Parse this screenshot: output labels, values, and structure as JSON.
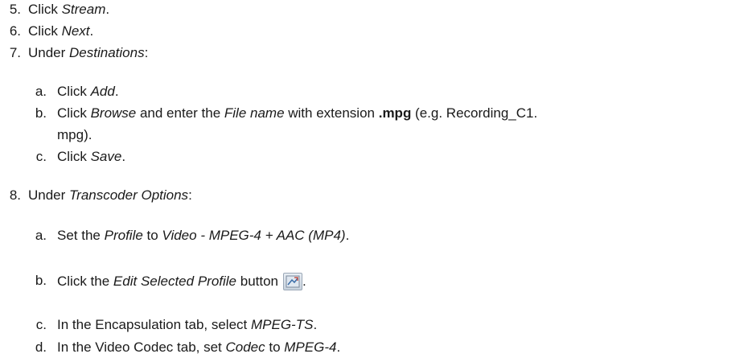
{
  "steps": [
    {
      "num": "5.",
      "pre": "Click ",
      "em": "Stream",
      "post": "."
    },
    {
      "num": "6.",
      "pre": "Click ",
      "em": "Next",
      "post": "."
    },
    {
      "num": "7.",
      "pre": "Under ",
      "em": "Destinations",
      "post": ":"
    }
  ],
  "step7_sub": {
    "a": {
      "letter": "a.",
      "pre": "Click ",
      "em": "Add",
      "post": "."
    },
    "b": {
      "letter": "b.",
      "t1": "Click ",
      "em1": "Browse",
      "t2": " and enter the ",
      "em2": "File name",
      "t3": " with extension ",
      "bold": ".mpg",
      "t4": " (e.g. Recording_C1.",
      "t5": "mpg)."
    },
    "c": {
      "letter": "c.",
      "pre": "Click ",
      "em": "Save",
      "post": "."
    }
  },
  "step8": {
    "num": "8.",
    "pre": "Under ",
    "em": "Transcoder Options",
    "post": ":"
  },
  "step8_sub": {
    "a": {
      "letter": "a.",
      "t1": "Set the ",
      "em1": "Profile",
      "t2": " to ",
      "em2": "Video - MPEG-4 + AAC (MP4)",
      "t3": "."
    },
    "b": {
      "letter": "b.",
      "t1": "Click the ",
      "em1": "Edit Selected Profile",
      "t2": " button",
      "t3": ".",
      "icon": "edit-profile-icon"
    },
    "c": {
      "letter": "c.",
      "t1": "In the Encapsulation tab, select ",
      "em1": "MPEG-TS",
      "t2": "."
    },
    "d": {
      "letter": "d.",
      "t1": "In the Video Codec tab, set ",
      "em1": "Codec",
      "t2": " to ",
      "em2": "MPEG-4",
      "t3": "."
    }
  }
}
